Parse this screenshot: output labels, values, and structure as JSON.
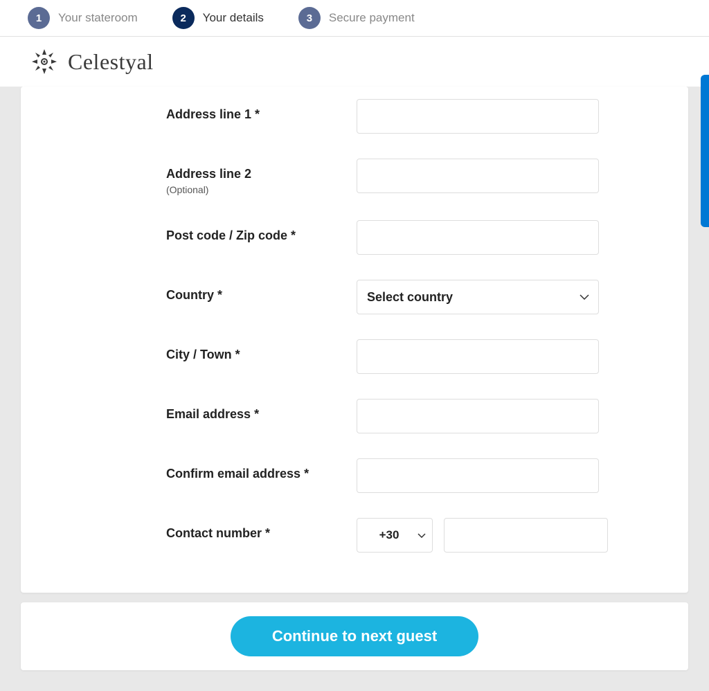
{
  "progress": {
    "steps": [
      {
        "num": "1",
        "label": "Your stateroom",
        "state": "done"
      },
      {
        "num": "2",
        "label": "Your details",
        "state": "active"
      },
      {
        "num": "3",
        "label": "Secure payment",
        "state": "upcoming"
      }
    ]
  },
  "brand": {
    "name": "Celestyal"
  },
  "form": {
    "address1": {
      "label": "Address line 1 *",
      "value": ""
    },
    "address2": {
      "label": "Address line 2",
      "sublabel": "(Optional)",
      "value": ""
    },
    "postcode": {
      "label": "Post code / Zip code *",
      "value": ""
    },
    "country": {
      "label": "Country *",
      "placeholder": "Select country"
    },
    "city": {
      "label": "City / Town *",
      "value": ""
    },
    "email": {
      "label": "Email address *",
      "value": ""
    },
    "confirm_email": {
      "label": "Confirm email address *",
      "value": ""
    },
    "contact": {
      "label": "Contact number *",
      "prefix": "+30",
      "value": ""
    }
  },
  "cta": {
    "continue": "Continue to next guest"
  }
}
